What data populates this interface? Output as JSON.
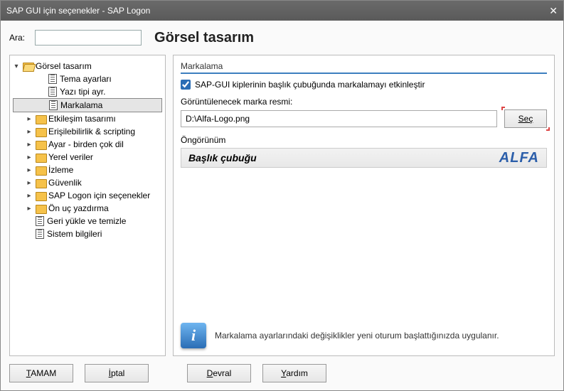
{
  "window": {
    "title": "SAP GUI için seçenekler - SAP Logon"
  },
  "search": {
    "label": "Ara:",
    "value": ""
  },
  "page_title": "Görsel tasarım",
  "tree": [
    {
      "indent": 0,
      "toggle": "▾",
      "icon": "folder-open",
      "label": "Görsel tasarım"
    },
    {
      "indent": 2,
      "toggle": "",
      "icon": "doc",
      "label": "Tema ayarları"
    },
    {
      "indent": 2,
      "toggle": "",
      "icon": "doc",
      "label": "Yazı tipi ayr."
    },
    {
      "indent": 2,
      "toggle": "",
      "icon": "doc",
      "label": "Markalama",
      "selected": true
    },
    {
      "indent": 1,
      "toggle": "▸",
      "icon": "folder",
      "label": "Etkileşim tasarımı"
    },
    {
      "indent": 1,
      "toggle": "▸",
      "icon": "folder",
      "label": "Erişilebilirlik & scripting"
    },
    {
      "indent": 1,
      "toggle": "▸",
      "icon": "folder",
      "label": "Ayar - birden çok dil"
    },
    {
      "indent": 1,
      "toggle": "▸",
      "icon": "folder",
      "label": "Yerel veriler"
    },
    {
      "indent": 1,
      "toggle": "▸",
      "icon": "folder",
      "label": "İzleme"
    },
    {
      "indent": 1,
      "toggle": "▸",
      "icon": "folder",
      "label": "Güvenlik"
    },
    {
      "indent": 1,
      "toggle": "▸",
      "icon": "folder",
      "label": "SAP Logon için seçenekler"
    },
    {
      "indent": 1,
      "toggle": "▸",
      "icon": "folder",
      "label": "Ön uç yazdırma"
    },
    {
      "indent": 1,
      "toggle": "",
      "icon": "doc",
      "label": "Geri yükle ve temizle"
    },
    {
      "indent": 1,
      "toggle": "",
      "icon": "doc",
      "label": "Sistem bilgileri"
    }
  ],
  "section": {
    "header": "Markalama"
  },
  "checkbox": {
    "label": "SAP-GUI kiplerinin başlık çubuğunda markalamayı etkinleştir",
    "checked": true
  },
  "imagepath": {
    "label": "Görüntülenecek marka resmi:",
    "value": "D:\\Alfa-Logo.png",
    "button": "Seç"
  },
  "preview": {
    "label": "Öngörünüm",
    "bar_text": "Başlık çubuğu",
    "logo_text": "ALFA"
  },
  "info": {
    "text": "Markalama ayarlarındaki değişiklikler yeni oturum başlattığınızda uygulanır."
  },
  "buttons": {
    "ok": "TAMAM",
    "ok_u": "T",
    "cancel": "İptal",
    "cancel_u": "İ",
    "apply": "Devral",
    "apply_u": "D",
    "help": "Yardım",
    "help_u": "Y"
  }
}
